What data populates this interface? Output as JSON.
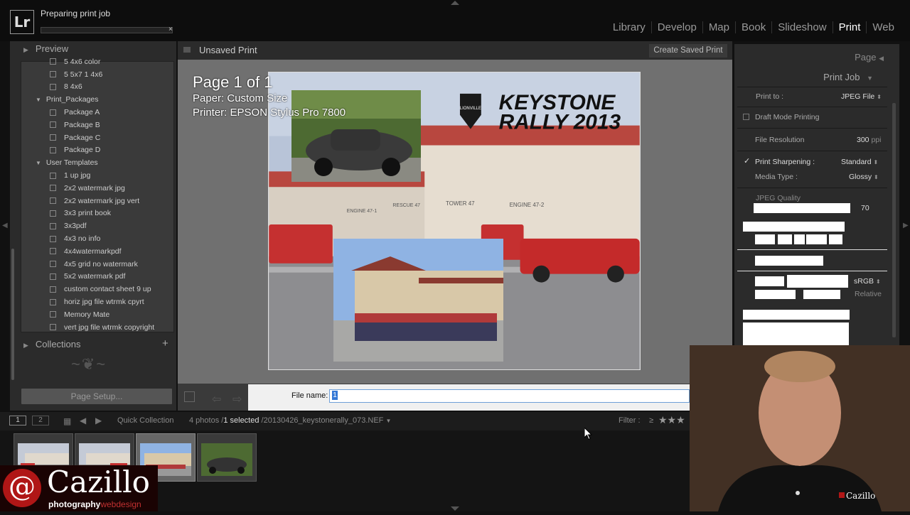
{
  "header": {
    "logo": "Lr",
    "progress_label": "Preparing print job",
    "progress_close": "×",
    "modules": [
      "Library",
      "Develop",
      "Map",
      "Book",
      "Slideshow",
      "Print",
      "Web"
    ],
    "active_module": "Print"
  },
  "left_panel": {
    "preview_label": "Preview",
    "templates": [
      {
        "label": "5 4x6 color",
        "type": "item"
      },
      {
        "label": "5 5x7 1 4x6",
        "type": "item"
      },
      {
        "label": "8 4x6",
        "type": "item"
      },
      {
        "label": "Print_Packages",
        "type": "folder"
      },
      {
        "label": "Package A",
        "type": "item"
      },
      {
        "label": "Package B",
        "type": "item"
      },
      {
        "label": "Package C",
        "type": "item"
      },
      {
        "label": "Package D",
        "type": "item"
      },
      {
        "label": "User Templates",
        "type": "folder"
      },
      {
        "label": "1 up jpg",
        "type": "item"
      },
      {
        "label": "2x2 watermark jpg",
        "type": "item"
      },
      {
        "label": "2x2 watermark jpg vert",
        "type": "item"
      },
      {
        "label": "3x3 print book",
        "type": "item"
      },
      {
        "label": "3x3pdf",
        "type": "item"
      },
      {
        "label": "4x3 no info",
        "type": "item"
      },
      {
        "label": "4x4watermarkpdf",
        "type": "item"
      },
      {
        "label": "4x5 grid no watermark",
        "type": "item"
      },
      {
        "label": "5x2 watermark pdf",
        "type": "item"
      },
      {
        "label": "custom contact sheet 9 up",
        "type": "item"
      },
      {
        "label": "horiz jpg file wtrmk cpyrt",
        "type": "item"
      },
      {
        "label": "Memory Mate",
        "type": "item"
      },
      {
        "label": "vert jpg file wtrmk copyright",
        "type": "item"
      }
    ],
    "collections_label": "Collections",
    "collections_add": "+",
    "page_setup_label": "Page Setup..."
  },
  "center": {
    "doc_title": "Unsaved Print",
    "create_saved_print": "Create Saved Print",
    "page_info": {
      "page": "Page 1 of 1",
      "paper": "Paper:  Custom Size",
      "printer": "Printer:  EPSON Stylus Pro 7800"
    },
    "photo_text": {
      "title_line1": "KEYSTONE",
      "title_line2": "RALLY 2013",
      "badge_top": "LIONVILLE",
      "station_labels": [
        "ENGINE 47-1",
        "RESCUE 47",
        "TOWER 47",
        "ENGINE 47-2"
      ]
    },
    "dialog": {
      "file_name_label": "File name:",
      "file_name_value": "1"
    }
  },
  "right_panel": {
    "page_section": "Page",
    "print_job_section": "Print Job",
    "print_to_label": "Print to :",
    "print_to_value": "JPEG File",
    "draft_mode_label": "Draft Mode Printing",
    "draft_mode_checked": false,
    "file_resolution_label": "File Resolution",
    "file_resolution_value": "300",
    "file_resolution_unit": "ppi",
    "print_sharpening_label": "Print Sharpening :",
    "print_sharpening_checked": true,
    "print_sharpening_value": "Standard",
    "media_type_label": "Media Type :",
    "media_type_value": "Glossy",
    "jpeg_quality_label": "JPEG Quality",
    "jpeg_quality_value": "70",
    "profile_value": "sRGB",
    "intent_value": "Relative"
  },
  "filmstrip": {
    "page_buttons": [
      "1",
      "2"
    ],
    "source": "Quick Collection",
    "count_text": "4 photos /",
    "selected_text": "1 selected",
    "filename": "/20130426_keystonerally_073.NEF",
    "filter_label": "Filter :",
    "filter_op": "≥"
  },
  "watermark": {
    "at": "@",
    "name": "Cazillo",
    "sub_main": "photography",
    "sub_accent": "webdesign"
  },
  "webcam": {
    "shirt_logo": "Cazillo"
  },
  "colors": {
    "accent_red": "#b01616",
    "selection_blue": "#3478d6"
  }
}
